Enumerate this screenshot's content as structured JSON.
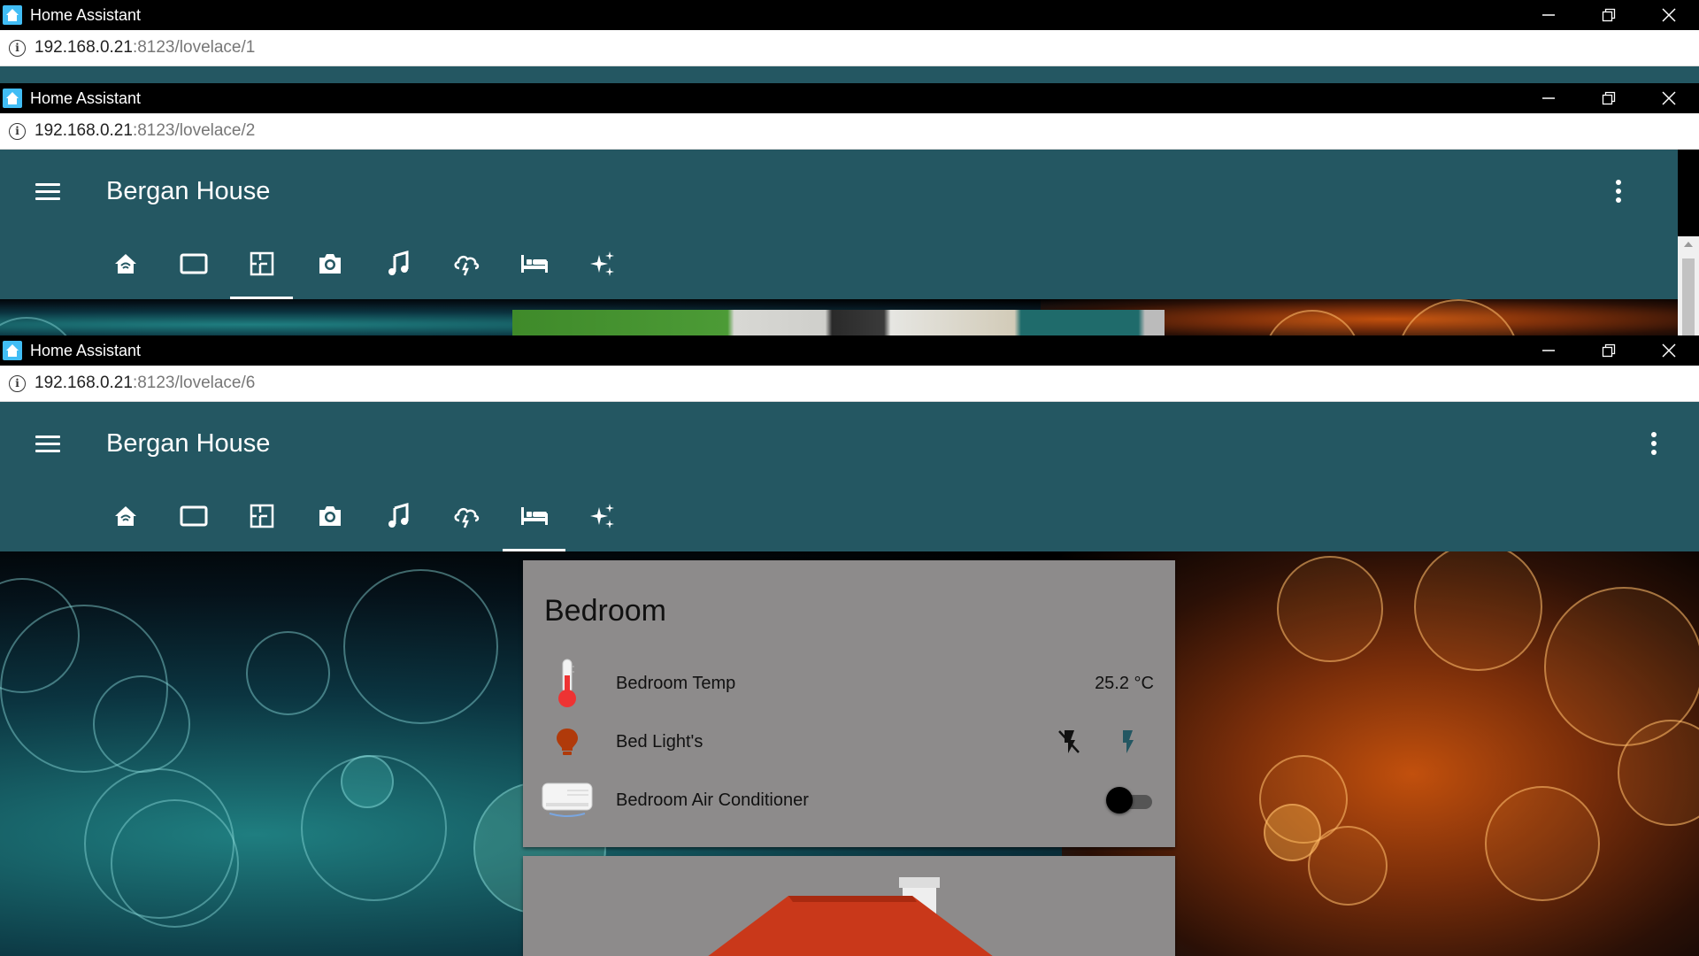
{
  "windows": [
    {
      "title": "Home Assistant",
      "url_host": "192.168.0.21",
      "url_path": ":8123/lovelace/1"
    },
    {
      "title": "Home Assistant",
      "url_host": "192.168.0.21",
      "url_path": ":8123/lovelace/2"
    },
    {
      "title": "Home Assistant",
      "url_host": "192.168.0.21",
      "url_path": ":8123/lovelace/6"
    }
  ],
  "app": {
    "title": "Bergan House",
    "tabs": [
      "home-icon",
      "tablet-icon",
      "floorplan-icon",
      "camera-icon",
      "music-icon",
      "weather-icon",
      "bed-icon",
      "scenes-icon"
    ],
    "active_tab_window2": 2,
    "active_tab_window3": 6,
    "primary_color": "#245762"
  },
  "card": {
    "title": "Bedroom",
    "entities": [
      {
        "name": "Bedroom Temp",
        "value": "25.2 °C",
        "icon": "thermometer-icon"
      },
      {
        "name": "Bed Light's",
        "icon": "bulb-icon",
        "actions": [
          "flash-off-icon",
          "flash-icon"
        ]
      },
      {
        "name": "Bedroom Air Conditioner",
        "icon": "air-conditioner-icon",
        "state": "off"
      }
    ]
  }
}
